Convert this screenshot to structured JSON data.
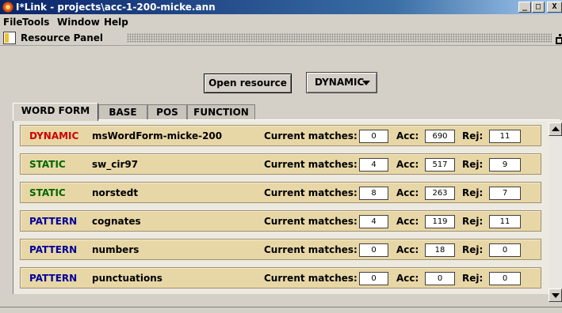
{
  "window": {
    "title": "I*Link - projects\\acc-1-200-micke.ann",
    "minimize": "_",
    "maximize": "□",
    "close": "X"
  },
  "menu": [
    "File",
    "Tools",
    "Window",
    "Help"
  ],
  "panel": {
    "label": "Resource Panel"
  },
  "toolbar": {
    "open_label": "Open resource",
    "type_select": "DYNAMIC"
  },
  "tabs": [
    "WORD FORM",
    "BASE",
    "POS",
    "FUNCTION"
  ],
  "labels": {
    "matches": "Current matches:",
    "acc": "Acc:",
    "rej": "Rej:"
  },
  "colors": {
    "dynamic": "#cc0000",
    "static": "#006600",
    "pattern": "#000099",
    "row_bg": "#e8d7a6"
  },
  "resources": [
    {
      "type": "DYNAMIC",
      "name": "msWordForm-micke-200",
      "matches": "0",
      "acc": "690",
      "rej": "11"
    },
    {
      "type": "STATIC",
      "name": "sw_cir97",
      "matches": "4",
      "acc": "517",
      "rej": "9"
    },
    {
      "type": "STATIC",
      "name": "norstedt",
      "matches": "8",
      "acc": "263",
      "rej": "7"
    },
    {
      "type": "PATTERN",
      "name": "cognates",
      "matches": "4",
      "acc": "119",
      "rej": "11"
    },
    {
      "type": "PATTERN",
      "name": "numbers",
      "matches": "0",
      "acc": "18",
      "rej": "0"
    },
    {
      "type": "PATTERN",
      "name": "punctuations",
      "matches": "0",
      "acc": "0",
      "rej": "0"
    }
  ]
}
